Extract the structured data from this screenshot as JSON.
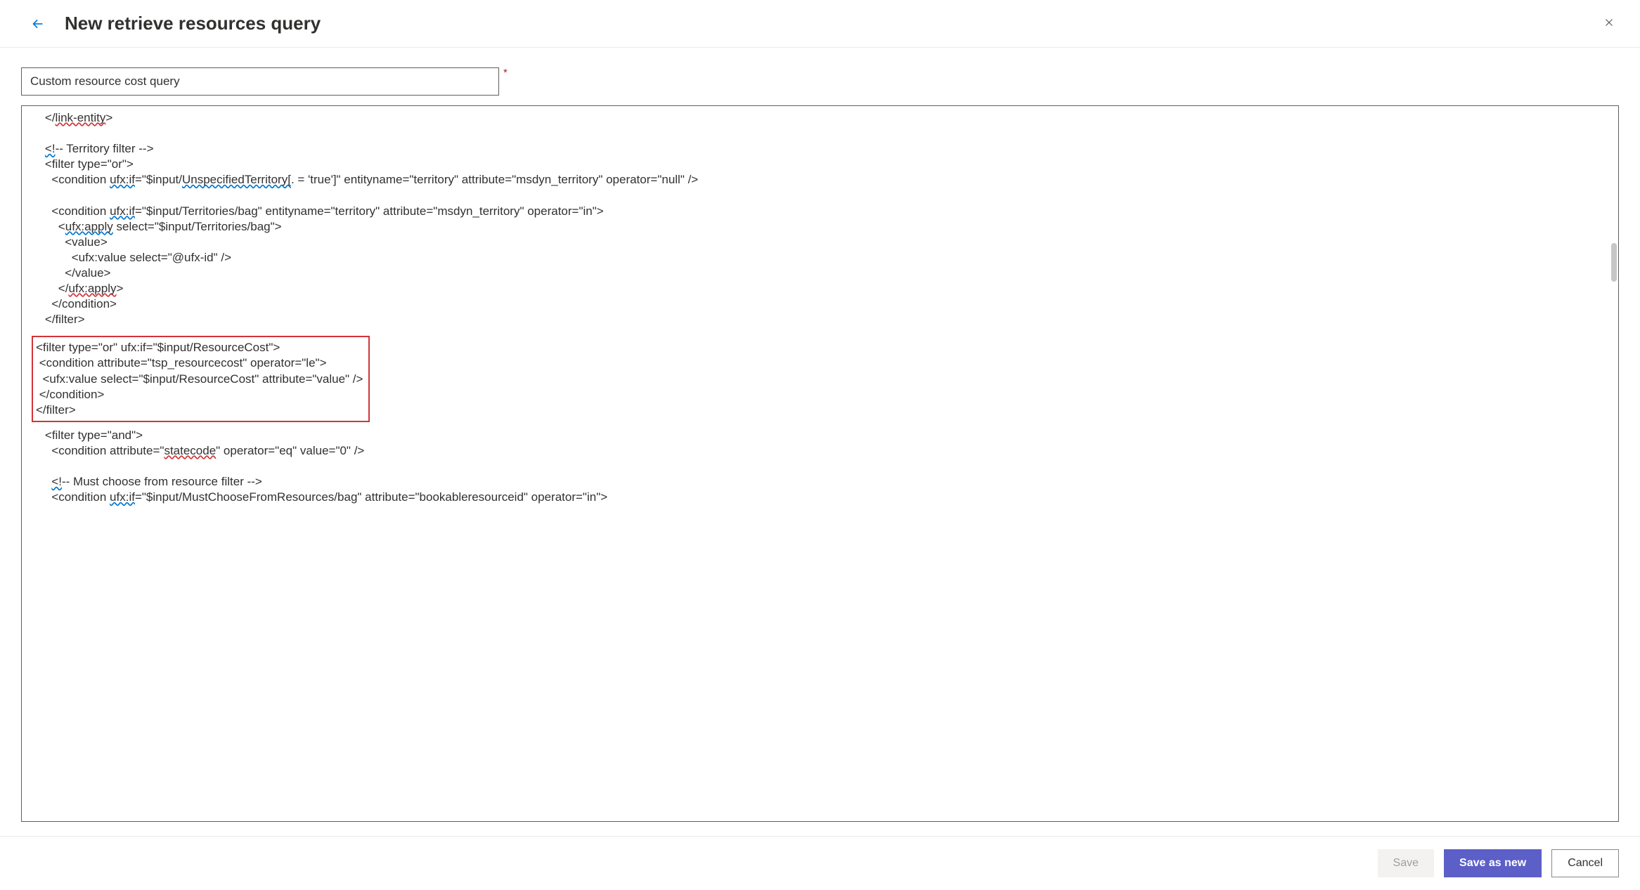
{
  "header": {
    "title": "New retrieve resources query"
  },
  "form": {
    "name_value": "Custom resource cost query",
    "required_mark": "*"
  },
  "editor": {
    "line_ent_close_pre": "    </",
    "line_ent_close_wavy": "link-entity",
    "line_ent_close_post": ">",
    "comment1_open": "<!",
    "comment1_rest": "-- Territory filter -->",
    "filter_or": "<filter type=\"or\">",
    "cond1_pre": "  <condition ",
    "cond1_ufx": "ufx:if",
    "cond1_mid": "=\"$input/",
    "cond1_uterr": "UnspecifiedTerritory[",
    "cond1_post": ". = 'true']\" entityname=\"territory\" attribute=\"msdyn_territory\" operator=\"null\" />",
    "cond2_pre": "  <condition ",
    "cond2_ufx": "ufx:if",
    "cond2_post": "=\"$input/Territories/bag\" entityname=\"territory\" attribute=\"msdyn_territory\" operator=\"in\">",
    "apply_pre": "    <",
    "apply_tag": "ufx:apply",
    "apply_post": " select=\"$input/Territories/bag\">",
    "value_open": "      <value>",
    "ufx_value": "        <ufx:value select=\"@ufx-id\" />",
    "value_close": "      </value>",
    "apply_close_pre": "    </",
    "apply_close_tag": "ufx:apply",
    "apply_close_post": ">",
    "cond_close": "  </condition>",
    "filter_close": "</filter>",
    "box_l1": "<filter type=\"or\" ufx:if=\"$input/ResourceCost\">",
    "box_l2": " <condition attribute=\"tsp_resourcecost\" operator=\"le\">",
    "box_l3": "  <ufx:value select=\"$input/ResourceCost\" attribute=\"value\" />",
    "box_l4": " </condition>",
    "box_l5": "</filter>",
    "and_open": "    <filter type=\"and\">",
    "statecode_pre": "      <condition attribute=\"",
    "statecode_w": "statecode",
    "statecode_post": "\" operator=\"eq\" value=\"0\" />",
    "comment2_open": "<!",
    "comment2_rest": "-- Must choose from resource filter -->",
    "must_pre": "      <condition ",
    "must_ufx": "ufx:if",
    "must_post": "=\"$input/MustChooseFromResources/bag\" attribute=\"bookableresourceid\" operator=\"in\">"
  },
  "footer": {
    "save": "Save",
    "save_as_new": "Save as new",
    "cancel": "Cancel"
  }
}
